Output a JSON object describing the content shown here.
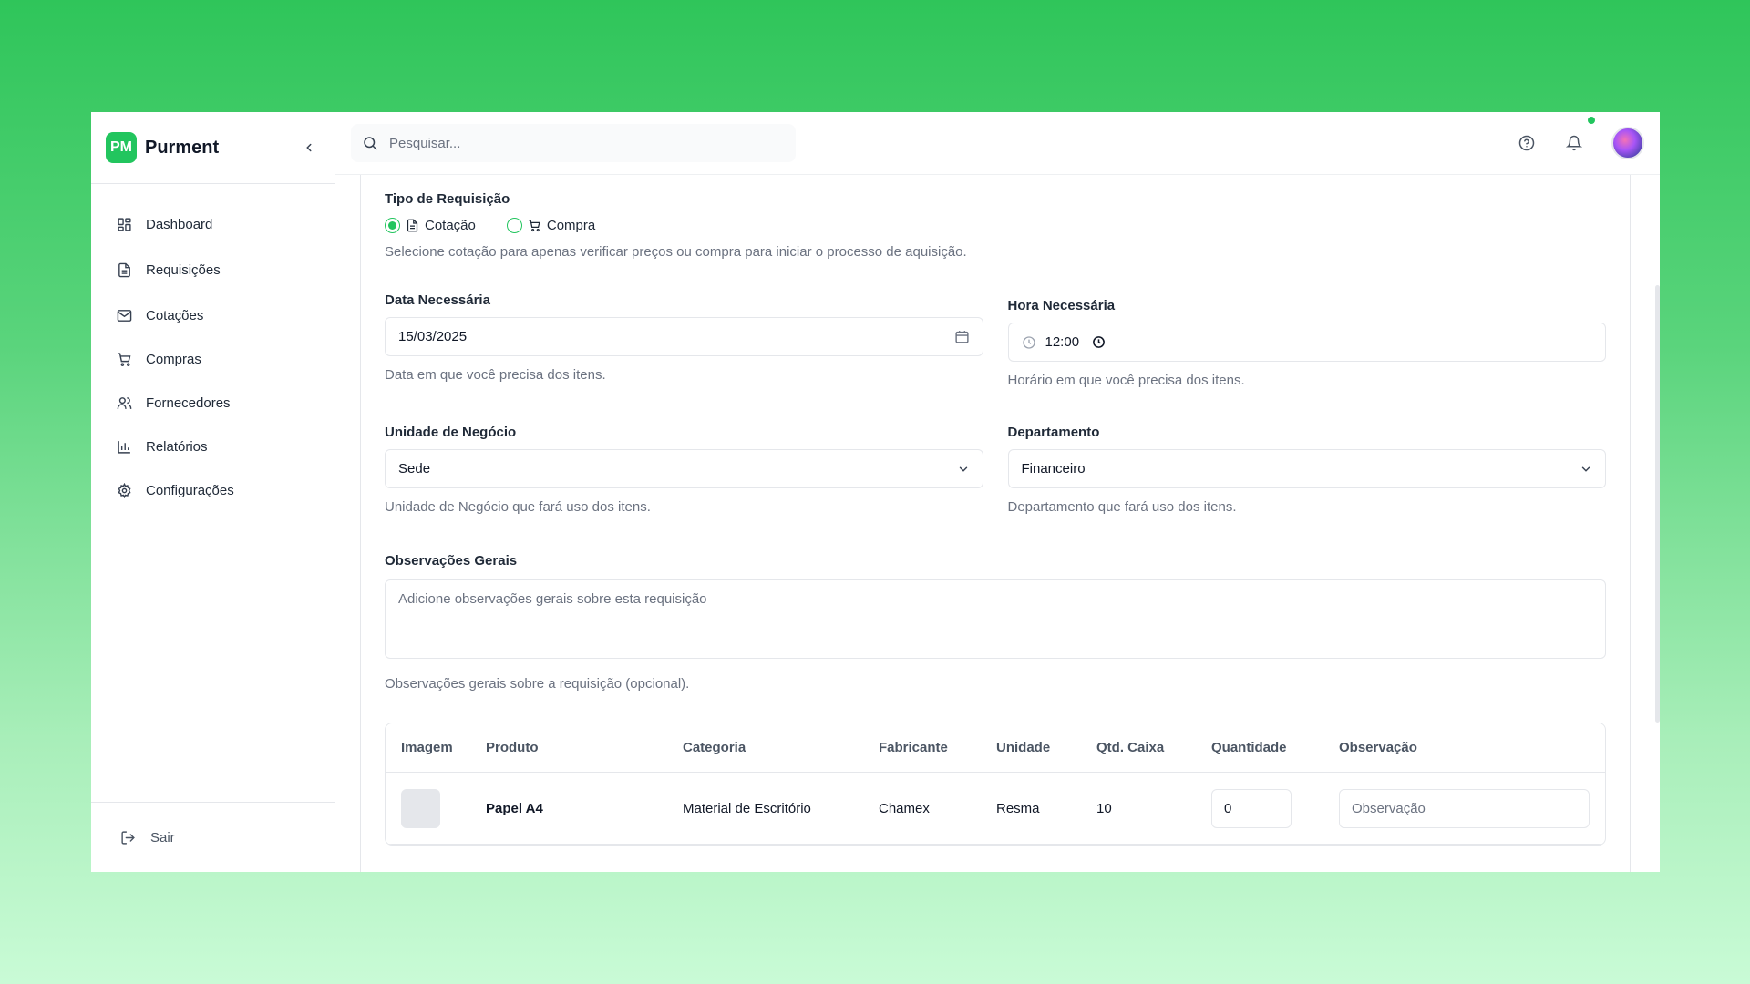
{
  "brand": {
    "badge": "PM",
    "name": "Purment"
  },
  "sidebar": {
    "items": [
      {
        "label": "Dashboard",
        "icon": "dashboard-grid-icon"
      },
      {
        "label": "Requisições",
        "icon": "file-text-icon"
      },
      {
        "label": "Cotações",
        "icon": "mail-icon"
      },
      {
        "label": "Compras",
        "icon": "cart-icon"
      },
      {
        "label": "Fornecedores",
        "icon": "users-icon"
      },
      {
        "label": "Relatórios",
        "icon": "bar-chart-icon"
      },
      {
        "label": "Configurações",
        "icon": "gear-icon"
      }
    ],
    "logout_label": "Sair"
  },
  "search": {
    "placeholder": "Pesquisar..."
  },
  "form": {
    "tipo": {
      "label": "Tipo de Requisição",
      "option_cotacao": "Cotação",
      "option_compra": "Compra",
      "selected": "Cotação",
      "help": "Selecione cotação para apenas verificar preços ou compra para iniciar o processo de aquisição."
    },
    "data": {
      "label": "Data Necessária",
      "value": "15/03/2025",
      "help": "Data em que você precisa dos itens."
    },
    "hora": {
      "label": "Hora Necessária",
      "value": "12:00",
      "help": "Horário em que você precisa dos itens."
    },
    "unidade": {
      "label": "Unidade de Negócio",
      "value": "Sede",
      "help": "Unidade de Negócio que fará uso dos itens."
    },
    "departamento": {
      "label": "Departamento",
      "value": "Financeiro",
      "help": "Departamento que fará uso dos itens."
    },
    "observacoes": {
      "label": "Observações Gerais",
      "placeholder": "Adicione observações gerais sobre esta requisição",
      "help": "Observações gerais sobre a requisição (opcional)."
    }
  },
  "table": {
    "headers": [
      "Imagem",
      "Produto",
      "Categoria",
      "Fabricante",
      "Unidade",
      "Qtd. Caixa",
      "Quantidade",
      "Observação"
    ],
    "rows": [
      {
        "produto": "Papel A4",
        "categoria": "Material de Escritório",
        "fabricante": "Chamex",
        "unidade": "Resma",
        "qtd_caixa": "10",
        "quantidade": "0",
        "observacao_placeholder": "Observação"
      }
    ]
  },
  "colors": {
    "accent": "#22c55e"
  }
}
